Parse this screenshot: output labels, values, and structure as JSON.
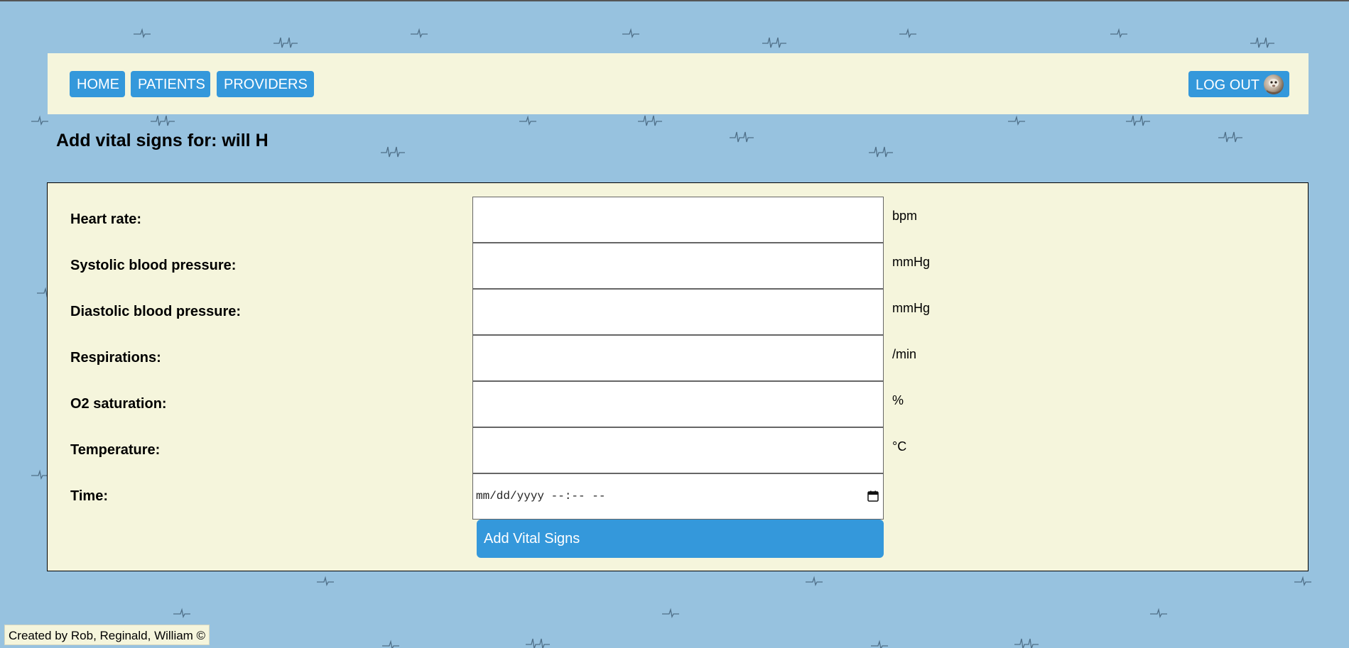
{
  "nav": {
    "home_label": "HOME",
    "patients_label": "PATIENTS",
    "providers_label": "PROVIDERS",
    "logout_label": "LOG OUT"
  },
  "page": {
    "title": "Add vital signs for: will H"
  },
  "form": {
    "fields": [
      {
        "label": "Heart rate:",
        "unit": "bpm",
        "value": ""
      },
      {
        "label": "Systolic blood pressure:",
        "unit": "mmHg",
        "value": ""
      },
      {
        "label": "Diastolic blood pressure:",
        "unit": "mmHg",
        "value": ""
      },
      {
        "label": "Respirations:",
        "unit": "/min",
        "value": ""
      },
      {
        "label": "O2 saturation:",
        "unit": "%",
        "value": ""
      },
      {
        "label": "Temperature:",
        "unit": "°C",
        "value": ""
      }
    ],
    "time": {
      "label": "Time:",
      "placeholder": "mm/dd/yyyy --:-- --"
    },
    "submit_label": "Add Vital Signs"
  },
  "footer": {
    "text": "Created by Rob, Reginald, William ©"
  },
  "colors": {
    "background": "#97c2df",
    "panel": "#f5f5dc",
    "button": "#3498db",
    "button_text": "#ffffff"
  },
  "icons": {
    "background_pattern": "ecg-heartbeat-icon",
    "logout_avatar": "avatar",
    "time_picker": "calendar-icon"
  }
}
